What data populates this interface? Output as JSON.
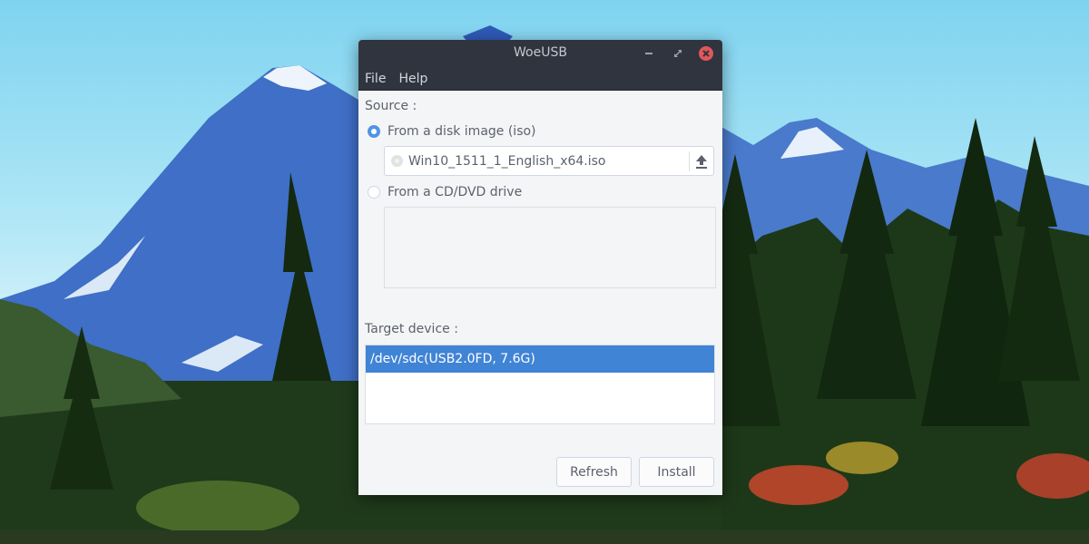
{
  "desktop": {
    "wallpaper": "mountain-lake-forest"
  },
  "window": {
    "title": "WoeUSB",
    "controls": {
      "minimize": "minimize-icon",
      "maximize": "maximize-icon",
      "close": "close-icon"
    },
    "colors": {
      "titlebar": "#2f343f",
      "close": "#e0575b",
      "accent": "#5294e2",
      "selection": "#4084d6"
    }
  },
  "menubar": {
    "items": [
      {
        "label": "File"
      },
      {
        "label": "Help"
      }
    ]
  },
  "source": {
    "label": "Source :",
    "options": [
      {
        "label": "From a disk image (iso)",
        "checked": true
      },
      {
        "label": "From a CD/DVD drive",
        "checked": false
      }
    ],
    "file_value": "Win10_1511_1_English_x64.iso",
    "upload_icon": "upload-icon",
    "cd_drives": []
  },
  "target": {
    "label": "Target device :",
    "devices": [
      {
        "label": "/dev/sdc(USB2.0FD,  7.6G)",
        "selected": true
      }
    ]
  },
  "actions": {
    "refresh_label": "Refresh",
    "install_label": "Install"
  }
}
